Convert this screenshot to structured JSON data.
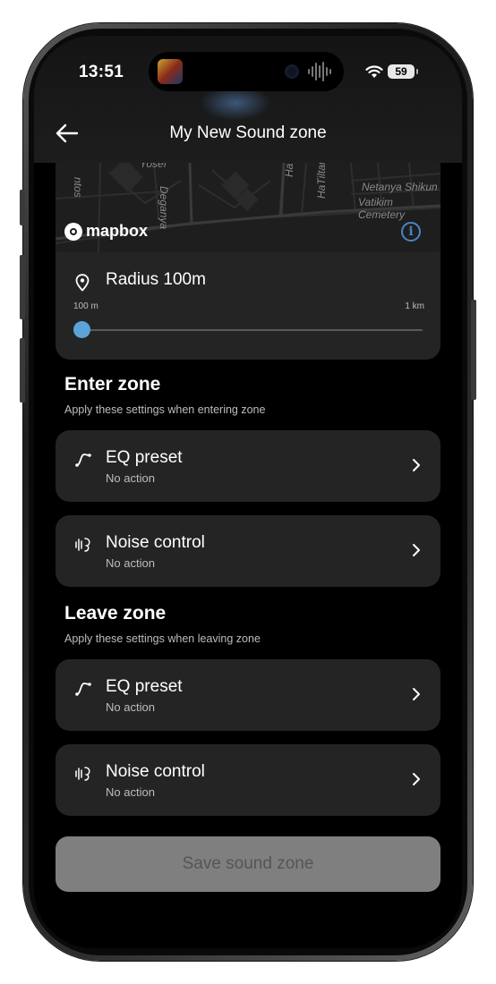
{
  "status_bar": {
    "time": "13:51",
    "battery": "59",
    "island_app_icon": "app-thumbnail-icon",
    "audio_icon": "waveform-icon"
  },
  "header": {
    "title": "My New Sound zone",
    "back_icon": "arrow-left-icon"
  },
  "map": {
    "attribution": "mapbox",
    "info_icon": "i",
    "street_labels": [
      "Yosef",
      "Deganya",
      "HaP",
      "HaTiltan",
      "ntos",
      "Netanya Shikun",
      "Vatikim Cemetery"
    ]
  },
  "radius": {
    "label": "Radius 100m",
    "min_label": "100 m",
    "max_label": "1 km",
    "slider_fraction": 0.0
  },
  "enter_zone": {
    "title": "Enter zone",
    "subtitle": "Apply these settings when entering zone",
    "items": [
      {
        "label": "EQ preset",
        "status": "No action",
        "icon": "eq-curve-icon"
      },
      {
        "label": "Noise control",
        "status": "No action",
        "icon": "noise-control-icon"
      }
    ]
  },
  "leave_zone": {
    "title": "Leave zone",
    "subtitle": "Apply these settings when leaving zone",
    "items": [
      {
        "label": "EQ preset",
        "status": "No action",
        "icon": "eq-curve-icon"
      },
      {
        "label": "Noise control",
        "status": "No action",
        "icon": "noise-control-icon"
      }
    ]
  },
  "save_button": {
    "label": "Save sound zone"
  },
  "colors": {
    "background": "#000000",
    "card": "#242424",
    "accent": "#5ba3d9",
    "disabled_button": "#7f7f7f",
    "info_blue": "#4c83c7"
  }
}
